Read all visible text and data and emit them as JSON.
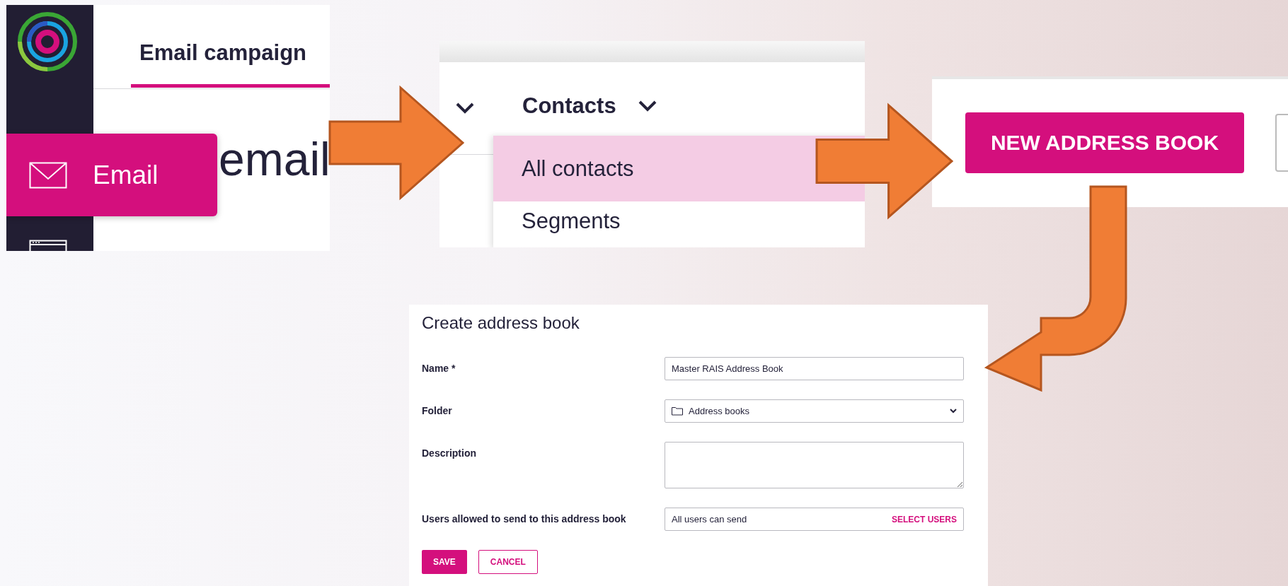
{
  "sidebar": {
    "items": [
      {
        "label": "Email",
        "selected": true
      }
    ]
  },
  "tabs": [
    {
      "label": "Email campaign",
      "selected": true
    }
  ],
  "page_heading": "email",
  "nav": {
    "menus": [
      {
        "label": "Contacts"
      }
    ]
  },
  "dropdown": {
    "items": [
      {
        "label": "All contacts",
        "selected": true
      },
      {
        "label": "Segments",
        "selected": false
      }
    ]
  },
  "toolbar": {
    "buttons": [
      "NEW ADDRESS BOOK"
    ]
  },
  "form": {
    "title": "Create address book",
    "fields": [
      {
        "label": "Name *",
        "kind": "text",
        "value": "Master RAIS Address Book"
      },
      {
        "label": "Folder",
        "kind": "select",
        "value": "Address books"
      },
      {
        "label": "Description",
        "kind": "textarea"
      },
      {
        "label": "Users allowed to send to this address book",
        "kind": "picker",
        "value": "All users can send",
        "action": "SELECT USERS"
      }
    ],
    "buttons": [
      {
        "label": "SAVE",
        "kind": "primary"
      },
      {
        "label": "CANCEL",
        "kind": "secondary"
      }
    ]
  }
}
